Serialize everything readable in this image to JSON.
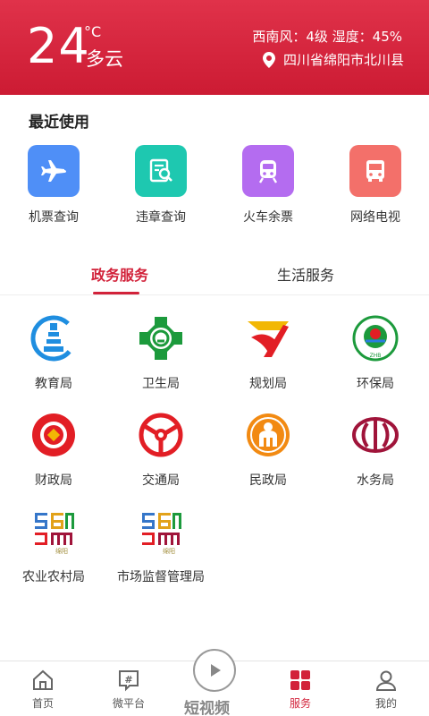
{
  "weather": {
    "temperature": "24",
    "unit": "°C",
    "condition": "多云",
    "wind_humidity": "西南风：4级   湿度：45%",
    "location": "四川省绵阳市北川县"
  },
  "recent": {
    "title": "最近使用",
    "items": [
      {
        "label": "机票查询",
        "icon": "airplane-icon",
        "color": "#4f8ff7"
      },
      {
        "label": "违章查询",
        "icon": "document-search-icon",
        "color": "#1ec8b0"
      },
      {
        "label": "火车余票",
        "icon": "train-icon",
        "color": "#b46cf0"
      },
      {
        "label": "网络电视",
        "icon": "bus-icon",
        "color": "#f3706a"
      }
    ]
  },
  "tabs": [
    {
      "label": "政务服务",
      "active": true
    },
    {
      "label": "生活服务",
      "active": false
    }
  ],
  "services": [
    {
      "label": "教育局",
      "icon": "education-bureau-logo"
    },
    {
      "label": "卫生局",
      "icon": "health-bureau-logo"
    },
    {
      "label": "规划局",
      "icon": "planning-bureau-logo"
    },
    {
      "label": "环保局",
      "icon": "environment-bureau-logo"
    },
    {
      "label": "财政局",
      "icon": "finance-bureau-logo"
    },
    {
      "label": "交通局",
      "icon": "transport-bureau-logo"
    },
    {
      "label": "民政局",
      "icon": "civil-affairs-logo"
    },
    {
      "label": "水务局",
      "icon": "water-bureau-logo"
    },
    {
      "label": "农业农村局",
      "icon": "agriculture-bureau-logo"
    },
    {
      "label": "市场监督管理局",
      "icon": "market-supervision-logo"
    }
  ],
  "bottom_nav": [
    {
      "label": "首页",
      "icon": "home-icon"
    },
    {
      "label": "微平台",
      "icon": "hashtag-icon"
    },
    {
      "label": "短视频",
      "icon": "play-icon"
    },
    {
      "label": "服务",
      "icon": "grid-icon",
      "active": true
    },
    {
      "label": "我的",
      "icon": "user-icon"
    }
  ],
  "colors": {
    "brand_red": "#d2223a",
    "header_top": "#e0324a"
  }
}
